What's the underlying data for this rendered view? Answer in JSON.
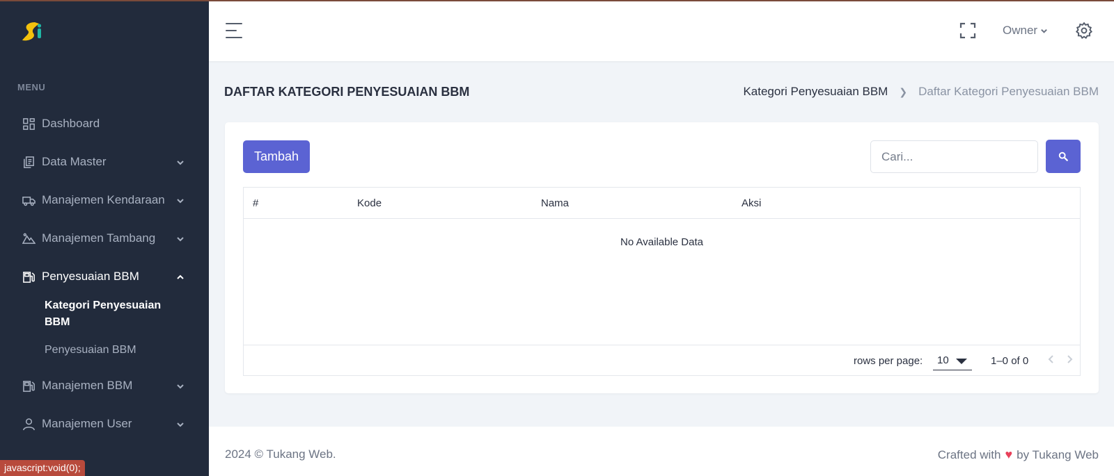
{
  "sidebar": {
    "menu_title": "MENU",
    "items": [
      {
        "label": "Dashboard",
        "icon": "dashboard-icon"
      },
      {
        "label": "Data Master",
        "icon": "document-icon"
      },
      {
        "label": "Manajemen Kendaraan",
        "icon": "truck-icon"
      },
      {
        "label": "Manajemen Tambang",
        "icon": "mountain-icon"
      },
      {
        "label": "Penyesuaian BBM",
        "icon": "fuel-icon"
      },
      {
        "label": "Manajemen BBM",
        "icon": "fuel-icon"
      },
      {
        "label": "Manajemen User",
        "icon": "user-icon"
      }
    ],
    "sub_items": [
      {
        "label": "Kategori Penyesuaian BBM"
      },
      {
        "label": "Penyesuaian BBM"
      }
    ]
  },
  "header": {
    "user": "Owner"
  },
  "page": {
    "title": "DAFTAR KATEGORI PENYESUAIAN BBM",
    "breadcrumb": [
      "Kategori Penyesuaian BBM",
      "Daftar Kategori Penyesuaian BBM"
    ]
  },
  "toolbar": {
    "add_label": "Tambah",
    "search_placeholder": "Cari..."
  },
  "table": {
    "columns": [
      "#",
      "Kode",
      "Nama",
      "Aksi"
    ],
    "empty_text": "No Available Data",
    "rows_per_page_label": "rows per page:",
    "rows_per_page": "10",
    "range": "1–0 of 0"
  },
  "footer": {
    "left": "2024 © Tukang Web.",
    "crafted": "Crafted with",
    "by": "by Tukang Web"
  },
  "status_bar": "javascript:void(0);",
  "colors": {
    "sidebar_bg": "#222b3c",
    "primary": "#5b63d3",
    "heart": "#e8405a",
    "logo_yellow": "#f4c20d",
    "logo_teal": "#1fb7a6"
  }
}
